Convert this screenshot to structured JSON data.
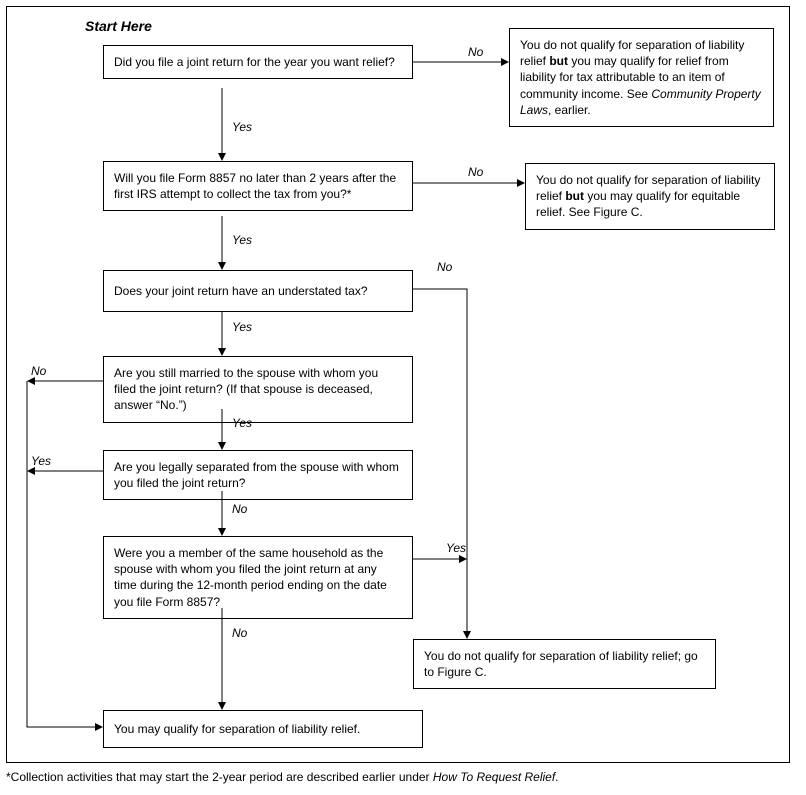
{
  "title": "Start Here",
  "boxes": {
    "q1": "Did you file a joint return for the year you want relief?",
    "r1a": "You do not qualify for separation of liability relief ",
    "r1b": "but",
    "r1c": " you may qualify for relief from liability for tax attributable to an item of community income. See ",
    "r1d": "Community Property Laws",
    "r1e": ", earlier.",
    "q2": "Will you file Form 8857 no later than 2 years after the first IRS attempt to collect the tax from you?*",
    "r2a": "You do not qualify for separation of liability relief ",
    "r2b": "but",
    "r2c": " you may qualify for equitable relief. See Figure C.",
    "q3": "Does your joint return have an understated tax?",
    "q4": "Are you still married to the spouse with whom you filed the joint return? (If that spouse is deceased, answer “No.”)",
    "q5": "Are you legally separated from the spouse with whom you filed the joint return?",
    "q6": "Were you a member of the same household as the spouse with whom you filed the joint return at any time during the 12-month period ending on the date you file Form 8857?",
    "r3": "You do not qualify for separation of liability relief; go to Figure C.",
    "r4": "You may qualify for separation of liability relief."
  },
  "labels": {
    "yes": "Yes",
    "no": "No"
  },
  "footnote_a": "*Collection activities that may start the 2-year period are described earlier under ",
  "footnote_b": "How To Request Relief",
  "footnote_c": "."
}
